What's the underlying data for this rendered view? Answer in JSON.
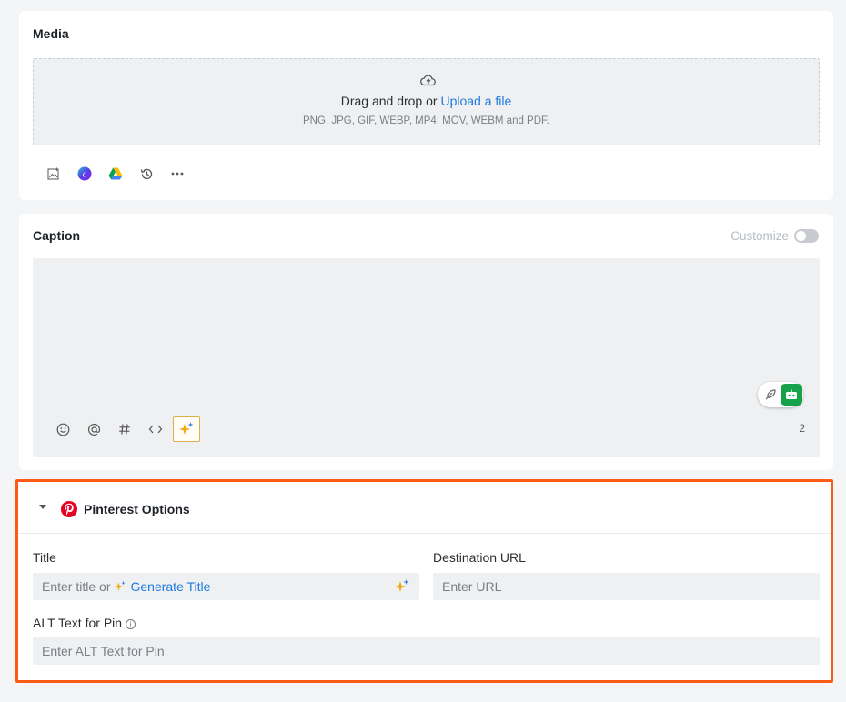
{
  "media": {
    "title": "Media",
    "drop_text": "Drag and drop or",
    "upload_link": "Upload a file",
    "formats": "PNG, JPG, GIF, WEBP, MP4, MOV, WEBM and PDF.",
    "tools": [
      "image-library-icon",
      "canva-icon",
      "google-drive-icon",
      "history-icon",
      "more-icon"
    ]
  },
  "caption": {
    "title": "Caption",
    "customize_label": "Customize",
    "customize_on": false,
    "char_count": "2",
    "tools": [
      "emoji-icon",
      "mention-icon",
      "hashtag-icon",
      "code-icon",
      "ai-sparkle-icon"
    ]
  },
  "pinterest": {
    "title": "Pinterest Options",
    "title_label": "Title",
    "title_placeholder_prefix": "Enter title or",
    "generate_title": "Generate Title",
    "dest_label": "Destination URL",
    "dest_placeholder": "Enter URL",
    "alt_label": "ALT Text for Pin",
    "alt_placeholder": "Enter ALT Text for Pin"
  },
  "colors": {
    "accent_link": "#1f7ae0",
    "highlight_border": "#ff5a14",
    "pinterest_red": "#e60023"
  }
}
